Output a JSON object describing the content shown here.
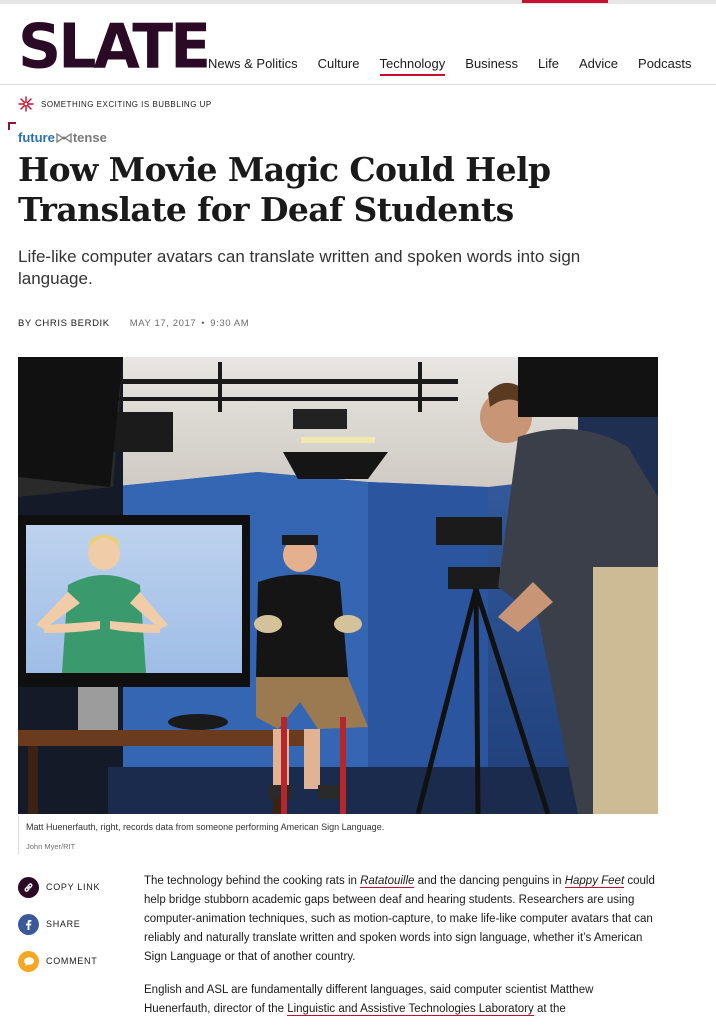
{
  "site": {
    "logo": "SLATE",
    "nav": [
      {
        "label": "News & Politics",
        "active": false
      },
      {
        "label": "Culture",
        "active": false
      },
      {
        "label": "Technology",
        "active": true
      },
      {
        "label": "Business",
        "active": false
      },
      {
        "label": "Life",
        "active": false
      },
      {
        "label": "Advice",
        "active": false
      },
      {
        "label": "Podcasts",
        "active": false
      }
    ]
  },
  "promo": {
    "text": "SOMETHING EXCITING IS BUBBLING UP",
    "icon": "asterisk-burst-icon"
  },
  "kicker": {
    "future": "future",
    "tense": "tense",
    "icon": "bowtie-icon"
  },
  "article": {
    "headline": "How Movie Magic Could Help Translate for Deaf Students",
    "dek": "Life-like computer avatars can translate written and spoken words into sign language.",
    "byline_prefix": "BY ",
    "author": "CHRIS BERDIK",
    "date": "MAY 17, 2017",
    "time": "9:30 AM",
    "image": {
      "caption": "Matt Huenerfauth, right, records data from someone performing American Sign Language.",
      "credit": "John Myer/RIT"
    },
    "share": [
      {
        "label": "COPY LINK",
        "icon": "link-icon",
        "color": "#2a0a24"
      },
      {
        "label": "SHARE",
        "icon": "facebook-icon",
        "color": "#3b5998"
      },
      {
        "label": "COMMENT",
        "icon": "comment-icon",
        "color": "#f5a623"
      }
    ],
    "p1": {
      "t1": "The technology behind the cooking rats in ",
      "link1": "Ratatouille",
      "t2": " and the dancing penguins in ",
      "link2": "Happy Feet",
      "t3": " could help bridge stubborn academic gaps between deaf and hearing students. Researchers are using computer-animation techniques, such as motion-capture, to make life-like computer avatars that can reliably and naturally translate written and spoken words into sign language, whether it’s American Sign Language or that of another country."
    },
    "p2": {
      "t1": "English and ASL are fundamentally different languages, said computer scientist Matthew Huenerfauth, director of the ",
      "link1": "Linguistic and Assistive Technologies Laboratory",
      "t2": " at the"
    }
  },
  "colors": {
    "accent": "#c8102e",
    "logo": "#2a0a24",
    "future": "#2a6fb7"
  }
}
